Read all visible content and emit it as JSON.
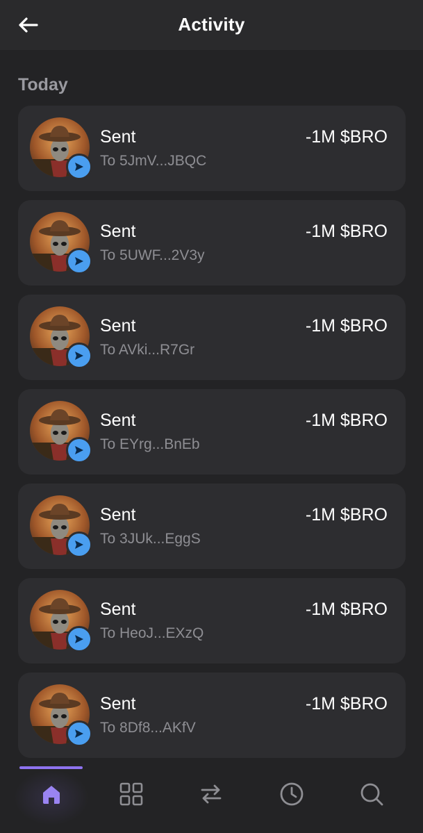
{
  "header": {
    "title": "Activity",
    "back_icon": "arrow-left-icon"
  },
  "section": {
    "title": "Today"
  },
  "activities": [
    {
      "type": "Sent",
      "to": "To 5JmV...JBQC",
      "amount": "-1M $BRO"
    },
    {
      "type": "Sent",
      "to": "To 5UWF...2V3y",
      "amount": "-1M $BRO"
    },
    {
      "type": "Sent",
      "to": "To AVki...R7Gr",
      "amount": "-1M $BRO"
    },
    {
      "type": "Sent",
      "to": "To EYrg...BnEb",
      "amount": "-1M $BRO"
    },
    {
      "type": "Sent",
      "to": "To 3JUk...EggS",
      "amount": "-1M $BRO"
    },
    {
      "type": "Sent",
      "to": "To HeoJ...EXzQ",
      "amount": "-1M $BRO"
    },
    {
      "type": "Sent",
      "to": "To 8Df8...AKfV",
      "amount": "-1M $BRO"
    }
  ],
  "nav": {
    "items": [
      "home-icon",
      "grid-icon",
      "swap-icon",
      "clock-icon",
      "search-icon"
    ],
    "active": "home-icon"
  },
  "colors": {
    "background": "#232325",
    "card": "#2d2d30",
    "accent": "#8e73f0",
    "badge": "#4a9ef0",
    "muted": "#8e8e93"
  }
}
